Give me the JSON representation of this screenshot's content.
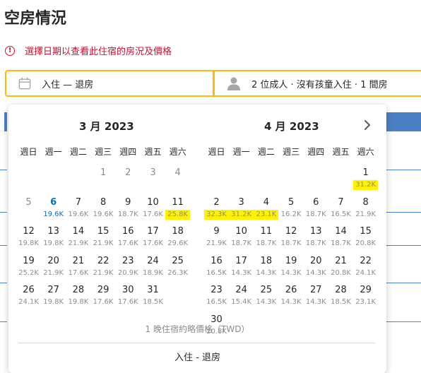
{
  "page": {
    "title": "空房情況"
  },
  "alert": {
    "icon": "exclamation-circle-icon",
    "text": "選擇日期以查看此住宿的房況及價格",
    "color": "#c8102e"
  },
  "search": {
    "dates_label": "入住 — 退房",
    "dates_icon": "calendar-icon",
    "guests_label": "2 位成人 · 沒有孩童入住 · 1 間房",
    "guests_icon": "person-icon",
    "border_color": "#febb02"
  },
  "calendar": {
    "weekdays": [
      "週日",
      "週一",
      "週二",
      "週三",
      "週四",
      "週五",
      "週六"
    ],
    "next_icon": "chevron-right-icon",
    "highlight_color": "#fff200",
    "today_color": "#0071c2",
    "months": [
      {
        "title": "3 月 2023",
        "first_weekday": 3,
        "days": [
          {
            "d": "1",
            "p": "",
            "past": true
          },
          {
            "d": "2",
            "p": "",
            "past": true
          },
          {
            "d": "3",
            "p": "",
            "past": true
          },
          {
            "d": "4",
            "p": "",
            "past": true
          },
          {
            "d": "5",
            "p": "",
            "past": true
          },
          {
            "d": "6",
            "p": "19.6K",
            "today": true
          },
          {
            "d": "7",
            "p": "19.6K"
          },
          {
            "d": "8",
            "p": "19.6K"
          },
          {
            "d": "9",
            "p": "18.7K"
          },
          {
            "d": "10",
            "p": "17.6K"
          },
          {
            "d": "11",
            "p": "25.8K",
            "hl": true
          },
          {
            "d": "12",
            "p": "19.8K"
          },
          {
            "d": "13",
            "p": "19.8K"
          },
          {
            "d": "14",
            "p": "21.9K"
          },
          {
            "d": "15",
            "p": "21.9K"
          },
          {
            "d": "16",
            "p": "17.6K"
          },
          {
            "d": "17",
            "p": "17.6K"
          },
          {
            "d": "18",
            "p": "29.6K"
          },
          {
            "d": "19",
            "p": "25.2K"
          },
          {
            "d": "20",
            "p": "21.9K"
          },
          {
            "d": "21",
            "p": "17.6K"
          },
          {
            "d": "22",
            "p": "21.9K"
          },
          {
            "d": "23",
            "p": "20.9K"
          },
          {
            "d": "24",
            "p": "18.9K"
          },
          {
            "d": "25",
            "p": "26.3K"
          },
          {
            "d": "26",
            "p": "24.1K"
          },
          {
            "d": "27",
            "p": "19.8K"
          },
          {
            "d": "28",
            "p": "19.8K"
          },
          {
            "d": "29",
            "p": "17.6K"
          },
          {
            "d": "30",
            "p": "17.6K"
          },
          {
            "d": "31",
            "p": "18.5K"
          }
        ]
      },
      {
        "title": "4 月 2023",
        "first_weekday": 6,
        "days": [
          {
            "d": "1",
            "p": "31.2K",
            "hl": true
          },
          {
            "d": "2",
            "p": "32.3K",
            "hl": true
          },
          {
            "d": "3",
            "p": "31.2K",
            "hl": true
          },
          {
            "d": "4",
            "p": "23.1K",
            "hl": true
          },
          {
            "d": "5",
            "p": "16.2K"
          },
          {
            "d": "6",
            "p": "18.7K"
          },
          {
            "d": "7",
            "p": "16.5K"
          },
          {
            "d": "8",
            "p": "21.9K"
          },
          {
            "d": "9",
            "p": "21.9K"
          },
          {
            "d": "10",
            "p": "18.7K"
          },
          {
            "d": "11",
            "p": "18.7K"
          },
          {
            "d": "12",
            "p": "18.7K"
          },
          {
            "d": "13",
            "p": "18.7K"
          },
          {
            "d": "14",
            "p": "18.7K"
          },
          {
            "d": "15",
            "p": "20.8K"
          },
          {
            "d": "16",
            "p": "16.5K"
          },
          {
            "d": "17",
            "p": "14.3K"
          },
          {
            "d": "18",
            "p": "14.3K"
          },
          {
            "d": "19",
            "p": "14.3K"
          },
          {
            "d": "20",
            "p": "14.3K"
          },
          {
            "d": "21",
            "p": "20.8K"
          },
          {
            "d": "22",
            "p": "24.1K"
          },
          {
            "d": "23",
            "p": "16.5K"
          },
          {
            "d": "24",
            "p": "15.4K"
          },
          {
            "d": "25",
            "p": "14.3K"
          },
          {
            "d": "26",
            "p": "14.3K"
          },
          {
            "d": "27",
            "p": "14.3K"
          },
          {
            "d": "28",
            "p": "18.5K"
          },
          {
            "d": "29",
            "p": "23.1K"
          },
          {
            "d": "30",
            "p": "20.8K"
          }
        ]
      }
    ],
    "footnote": "1 晚住宿約略價格（TWD）",
    "footer_label": "入住 - 退房"
  }
}
